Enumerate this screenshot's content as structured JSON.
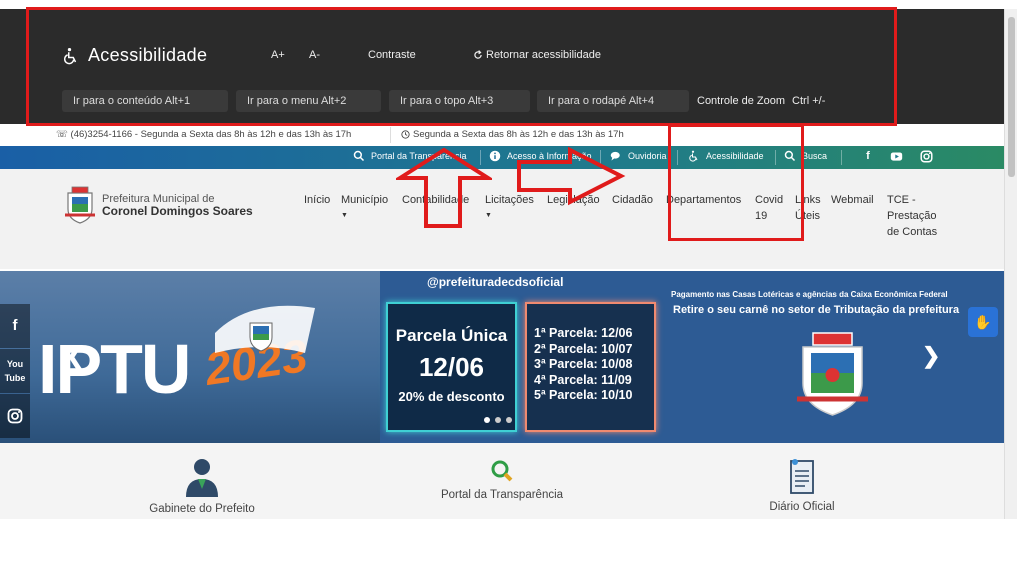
{
  "accessibility": {
    "title": "Acessibilidade",
    "font_increase": "A+",
    "font_decrease": "A-",
    "contrast": "Contraste",
    "reset": "Retornar acessibilidade",
    "skip_links": [
      {
        "label": "Ir para o conteúdo  Alt+1"
      },
      {
        "label": "Ir para o menu  Alt+2"
      },
      {
        "label": "Ir para o topo  Alt+3"
      },
      {
        "label": "Ir para o rodapé  Alt+4"
      }
    ],
    "zoom_label": "Controle de Zoom",
    "zoom_keys": "Ctrl +/-"
  },
  "info_line": {
    "phone": "(46)3254-1166 - Segunda a Sexta das 8h às 12h e das 13h às 17h",
    "hours": "Segunda a Sexta das 8h às 12h e das 13h às 17h"
  },
  "top_strip": {
    "items": [
      {
        "label": "Portal da Transparência"
      },
      {
        "label": "Acesso à Informação"
      },
      {
        "label": "Ouvidoria"
      },
      {
        "label": "Acessibilidade"
      },
      {
        "label": "Busca"
      }
    ],
    "social": [
      "f",
      "yt",
      "ig"
    ]
  },
  "logo": {
    "line1": "Prefeitura Municipal de",
    "line2": "Coronel Domingos Soares"
  },
  "menu": [
    {
      "label": "Início"
    },
    {
      "label": "Município"
    },
    {
      "label": "Contabilidade"
    },
    {
      "label": "Licitações"
    },
    {
      "label": "Legislação"
    },
    {
      "label": "Cidadão"
    },
    {
      "label": "Departamentos"
    },
    {
      "label": "Covid 19"
    },
    {
      "label": "Links Úteis"
    },
    {
      "label": "Webmail"
    },
    {
      "label": "TCE - Prestação de Contas"
    }
  ],
  "banner": {
    "iptu": "IPTU",
    "year": "2023",
    "handle": "@prefeituradecdsoficial",
    "single_title": "Parcela Única",
    "single_date": "12/06",
    "single_discount": "20% de desconto",
    "installments": [
      "1ª Parcela: 12/06",
      "2ª Parcela: 10/07",
      "3ª Parcela: 10/08",
      "4ª Parcela: 11/09",
      "5ª Parcela: 10/10"
    ],
    "pay_line": "Pagamento nas Casas Lotéricas e agências da Caixa Econômica Federal",
    "pickup_line": "Retire o seu carnê no setor de Tributação da prefeitura"
  },
  "quick_links": [
    {
      "label": "Gabinete do Prefeito"
    },
    {
      "label": "Portal da Transparência"
    },
    {
      "label": "Diário Oficial"
    }
  ],
  "colors": {
    "annotation": "#e01b1b",
    "acc_bar": "#2b2b2b",
    "strip_start": "#1a5fa6",
    "strip_end": "#2a8a64"
  }
}
